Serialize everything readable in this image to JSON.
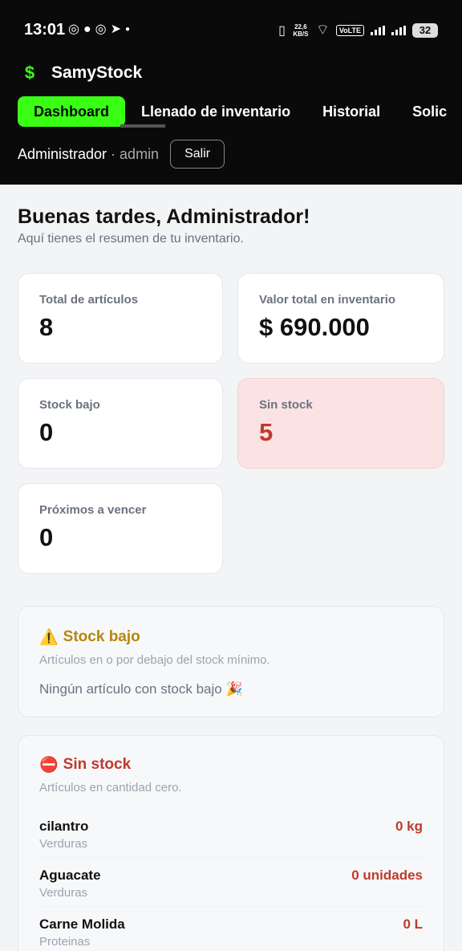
{
  "status_bar": {
    "time": "13:01",
    "speed": "22,6 KB/S",
    "network": "VoLTE",
    "battery": "32"
  },
  "app": {
    "logo": "$",
    "name": "SamyStock"
  },
  "tabs": [
    {
      "label": "Dashboard",
      "active": true
    },
    {
      "label": "Llenado de inventario",
      "active": false
    },
    {
      "label": "Historial",
      "active": false
    },
    {
      "label": "Solic",
      "active": false
    }
  ],
  "user": {
    "name": "Administrador",
    "separator": " · ",
    "role": "admin",
    "logout_label": "Salir"
  },
  "greeting": {
    "title": "Buenas tardes, Administrador!",
    "subtitle": "Aquí tienes el resumen de tu inventario."
  },
  "stats": [
    {
      "label": "Total de artículos",
      "value": "8"
    },
    {
      "label": "Valor total en inventario",
      "value": "$ 690.000"
    },
    {
      "label": "Stock bajo",
      "value": "0"
    },
    {
      "label": "Sin stock",
      "value": "5"
    },
    {
      "label": "Próximos a vencer",
      "value": "0"
    }
  ],
  "low_stock": {
    "icon": "⚠️",
    "title": "Stock bajo",
    "subtitle": "Artículos en o por debajo del stock mínimo.",
    "empty": "Ningún artículo con stock bajo 🎉"
  },
  "no_stock": {
    "icon": "⛔",
    "title": "Sin stock",
    "subtitle": "Artículos en cantidad cero.",
    "items": [
      {
        "name": "cilantro",
        "category": "Verduras",
        "qty": "0 kg"
      },
      {
        "name": "Aguacate",
        "category": "Verduras",
        "qty": "0 unidades"
      },
      {
        "name": "Carne Molida",
        "category": "Proteinas",
        "qty": "0 L"
      }
    ]
  }
}
